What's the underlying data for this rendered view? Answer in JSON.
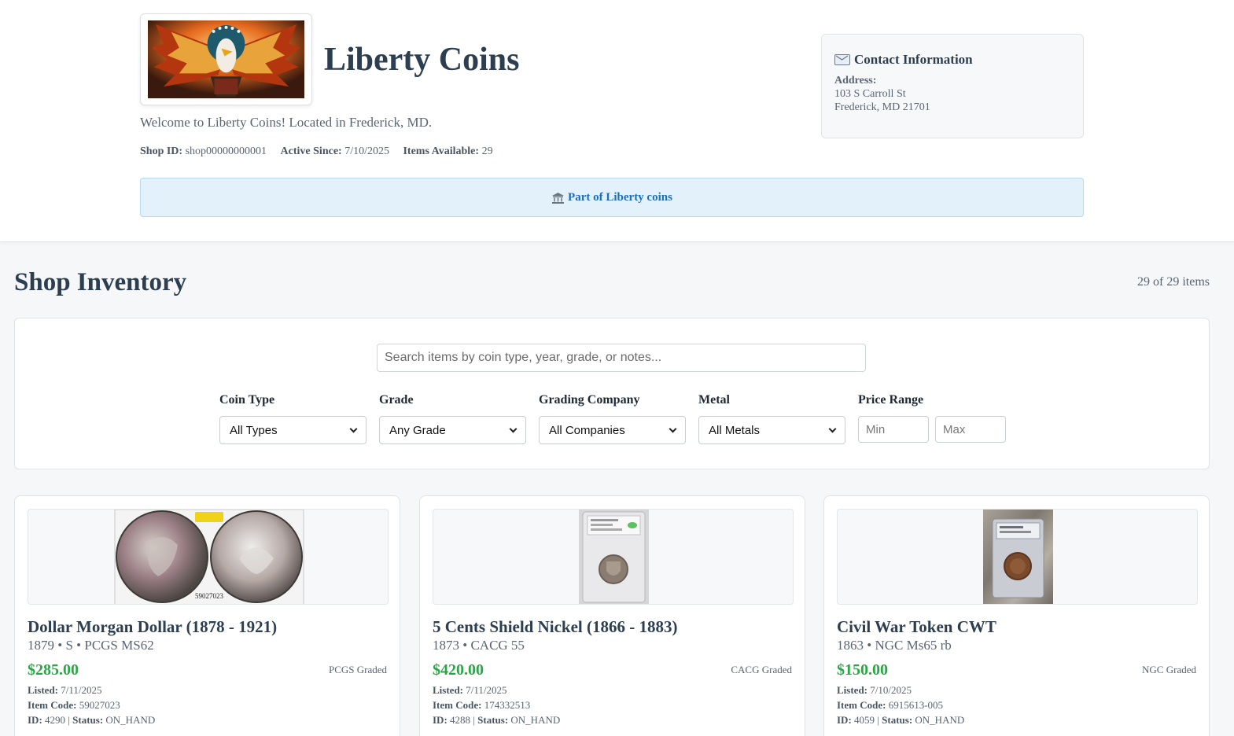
{
  "shop": {
    "name": "Liberty Coins",
    "welcome": "Welcome to Liberty Coins! Located in Frederick, MD.",
    "shop_id_label": "Shop ID:",
    "shop_id": "shop00000000001",
    "active_label": "Active Since:",
    "active_since": "7/10/2025",
    "items_label": "Items Available:",
    "items_available": "29"
  },
  "contact": {
    "title": "Contact Information",
    "address_label": "Address:",
    "address_line1": "103 S Carroll St",
    "address_line2": "Frederick, MD 21701"
  },
  "banner": {
    "link_text": "Part of Liberty coins"
  },
  "inventory": {
    "title": "Shop Inventory",
    "count_text": "29 of 29 items"
  },
  "filters": {
    "search_placeholder": "Search items by coin type, year, grade, or notes...",
    "coin_type_label": "Coin Type",
    "coin_type_value": "All Types",
    "grade_label": "Grade",
    "grade_value": "Any Grade",
    "company_label": "Grading Company",
    "company_value": "All Companies",
    "metal_label": "Metal",
    "metal_value": "All Metals",
    "price_label": "Price Range",
    "min_placeholder": "Min",
    "max_placeholder": "Max"
  },
  "labels": {
    "listed": "Listed:",
    "item_code": "Item Code:",
    "id": "ID:",
    "status": "Status:"
  },
  "items": [
    {
      "name": "Dollar Morgan Dollar (1878 - 1921)",
      "subtitle": "1879 • S • PCGS MS62",
      "price": "$285.00",
      "graded": "PCGS Graded",
      "listed": "7/11/2025",
      "item_code": "59027023",
      "id": "4290",
      "status": "ON_HAND",
      "cert_text": "59027023"
    },
    {
      "name": "5 Cents Shield Nickel (1866 - 1883)",
      "subtitle": "1873 • CACG 55",
      "price": "$420.00",
      "graded": "CACG Graded",
      "listed": "7/11/2025",
      "item_code": "174332513",
      "id": "4288",
      "status": "ON_HAND"
    },
    {
      "name": "Civil War Token CWT",
      "subtitle": "1863 • NGC Ms65 rb",
      "price": "$150.00",
      "graded": "NGC Graded",
      "listed": "7/10/2025",
      "item_code": "6915613-005",
      "id": "4059",
      "status": "ON_HAND"
    }
  ]
}
